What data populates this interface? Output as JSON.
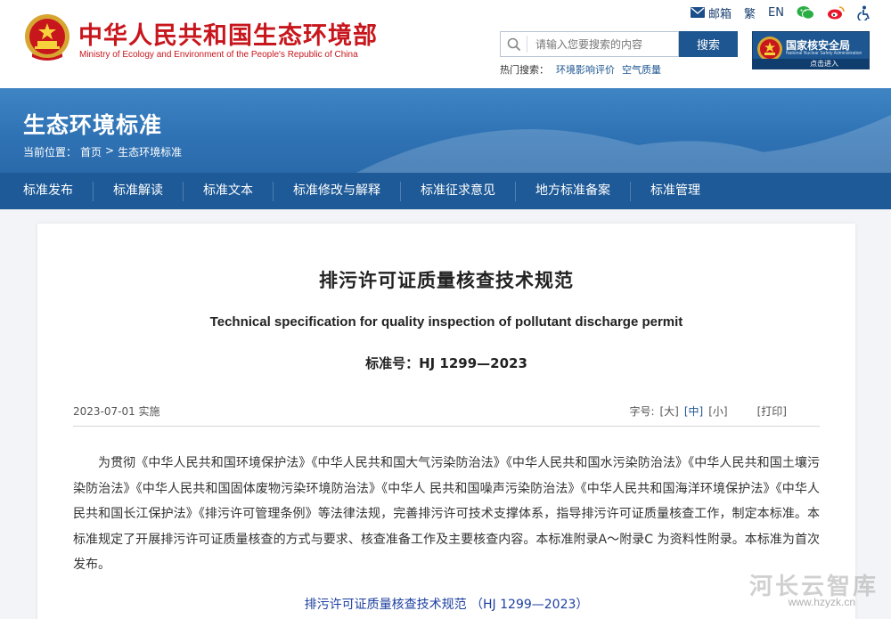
{
  "header": {
    "site_title": "中华人民共和国生态环境部",
    "site_subtitle": "Ministry of Ecology and Environment of the People's Republic of China",
    "toplinks": {
      "mail": "邮箱",
      "traditional": "繁",
      "english": "EN"
    },
    "search": {
      "placeholder": "请输入您要搜索的内容",
      "button": "搜索"
    },
    "hot": {
      "label": "热门搜索：",
      "items": [
        "环境影响评价",
        "空气质量"
      ]
    },
    "nnsa": {
      "title": "国家核安全局",
      "subtitle": "National Nuclear Safety Administration",
      "enter": "点击进入"
    }
  },
  "banner": {
    "title": "生态环境标准",
    "crumb_label": "当前位置：",
    "crumb_home": "首页",
    "crumb_sep": ">",
    "crumb_current": "生态环境标准"
  },
  "nav": [
    "标准发布",
    "标准解读",
    "标准文本",
    "标准修改与解释",
    "标准征求意见",
    "地方标准备案",
    "标准管理"
  ],
  "doc": {
    "title": "排污许可证质量核查技术规范",
    "title_en": "Technical specification for quality inspection of pollutant discharge permit",
    "number": "标准号：HJ 1299—2023",
    "date": "2023-07-01 实施",
    "font_label": "字号:",
    "font_large": "[大]",
    "font_medium": "[中]",
    "font_small": "[小]",
    "print": "[打印]",
    "body": "为贯彻《中华人民共和国环境保护法》《中华人民共和国大气污染防治法》《中华人民共和国水污染防治法》《中华人民共和国土壤污染防治法》《中华人民共和国固体废物污染环境防治法》《中华人 民共和国噪声污染防治法》《中华人民共和国海洋环境保护法》《中华人民共和国长江保护法》《排污许可管理条例》等法律法规，完善排污许可技术支撑体系，指导排污许可证质量核查工作，制定本标准。本标准规定了开展排污许可证质量核查的方式与要求、核查准备工作及主要核查内容。本标准附录A～附录C 为资料性附录。本标准为首次发布。",
    "link": "排污许可证质量核查技术规范 （HJ 1299—2023）"
  },
  "watermark": {
    "text": "河长云智库",
    "url": "www.hzyzk.cn"
  },
  "colors": {
    "brand_red": "#c8161d",
    "nav_blue": "#1e5a97",
    "banner_blue": "#3f85c4"
  }
}
